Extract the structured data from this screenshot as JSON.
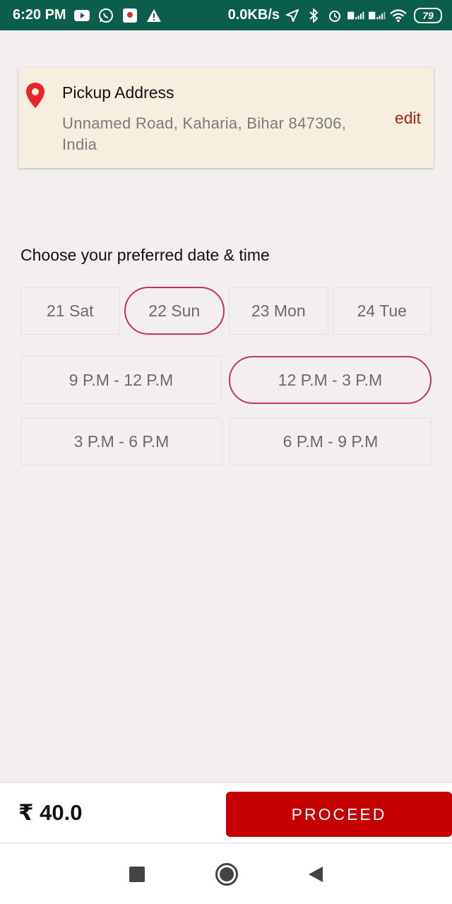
{
  "status_bar": {
    "time": "6:20 PM",
    "speed": "0.0KB/s",
    "battery": "79"
  },
  "address": {
    "title": "Pickup Address",
    "text": "Unnamed Road, Kaharia, Bihar 847306, India",
    "edit_label": "edit"
  },
  "schedule": {
    "heading": "Choose your preferred date & time",
    "dates": [
      {
        "label": "21 Sat",
        "selected": false
      },
      {
        "label": "22 Sun",
        "selected": true
      },
      {
        "label": "23 Mon",
        "selected": false
      },
      {
        "label": "24 Tue",
        "selected": false
      }
    ],
    "slots": [
      {
        "label": "9 P.M - 12 P.M",
        "selected": false
      },
      {
        "label": "12 P.M - 3 P.M",
        "selected": true
      },
      {
        "label": "3 P.M - 6 P.M",
        "selected": false
      },
      {
        "label": "6 P.M - 9 P.M",
        "selected": false
      }
    ]
  },
  "footer": {
    "price": "₹ 40.0",
    "proceed_label": "PROCEED"
  },
  "colors": {
    "accent_red": "#c50000",
    "selection_border": "#c2306a",
    "status_bar": "#0b5d4c",
    "card_bg": "#f6efdf"
  }
}
